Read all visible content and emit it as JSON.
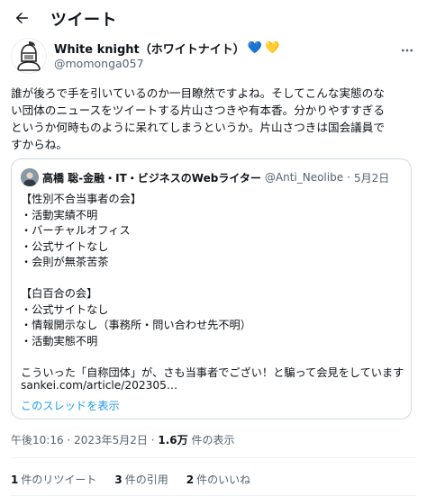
{
  "header": {
    "title": "ツイート",
    "back_icon": "arrow-left-icon"
  },
  "author": {
    "name": "White knight（ホワイトナイト）",
    "hearts": [
      "💙",
      "💛"
    ],
    "heart_colors": [
      "#3b94d9",
      "#f5c33b"
    ],
    "handle": "@momonga057"
  },
  "tweet": {
    "lines": [
      "誰が後ろで手を引いているのか一目瞭然ですよね。そしてこんな実態のな",
      "い団体のニュースをツイートする片山さつきや有本香。分かりやすすぎる",
      "というか何時ものように呆れてしまうというか。片山さつきは国会議員で",
      "すからね。"
    ]
  },
  "quote": {
    "name": "高橋 聡-金融・IT・ビジネスのWebライター",
    "handle": "@Anti_Neolibe",
    "separator": "·",
    "date": "5月2日",
    "lines": [
      "【性別不合当事者の会】",
      "・活動実績不明",
      "・バーチャルオフィス",
      "・公式サイトなし",
      "・会則が無茶苦茶",
      "",
      "【白百合の会】",
      "・公式サイトなし",
      "・情報開示なし（事務所・問い合わせ先不明）",
      "・活動実態不明",
      "",
      "こういった「自称団体」が、さも当事者でござい！と騙って会見をしています"
    ],
    "link": "sankei.com/article/202305…",
    "show_thread": "このスレッドを表示"
  },
  "meta": {
    "time": "午後10:16",
    "dot1": "·",
    "date": "2023年5月2日",
    "dot2": "·",
    "views_num": "1.6万",
    "views_label": "件の表示"
  },
  "stats": [
    {
      "num": "1",
      "label": "件のリツイート"
    },
    {
      "num": "3",
      "label": "件の引用"
    },
    {
      "num": "2",
      "label": "件のいいね"
    }
  ]
}
